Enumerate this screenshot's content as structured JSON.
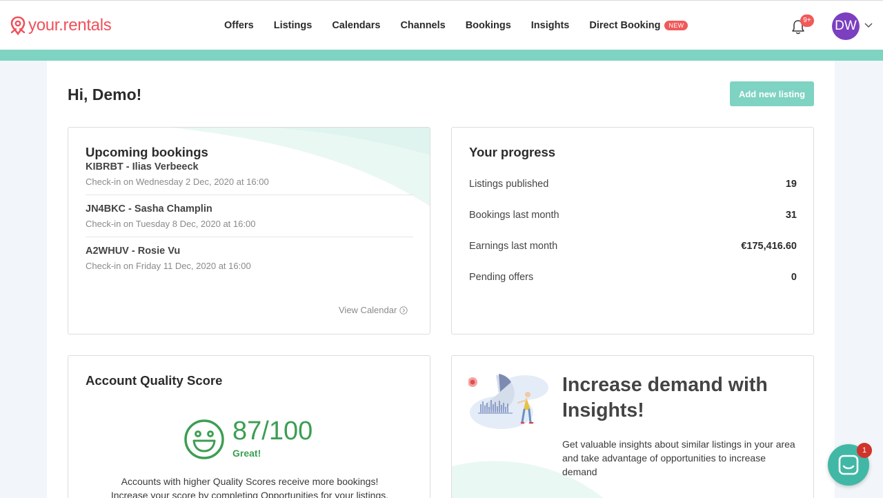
{
  "brand": {
    "name": "your.rentals",
    "color": "#f0505a"
  },
  "nav": {
    "items": [
      {
        "label": "Offers"
      },
      {
        "label": "Listings"
      },
      {
        "label": "Calendars"
      },
      {
        "label": "Channels"
      },
      {
        "label": "Bookings"
      },
      {
        "label": "Insights"
      },
      {
        "label": "Direct Booking",
        "badge": "NEW"
      }
    ]
  },
  "notifications": {
    "count": "9+",
    "icon": "bell-icon"
  },
  "user": {
    "initials": "DW",
    "avatar_color": "#7b3fbf"
  },
  "page": {
    "greeting": "Hi, Demo!",
    "add_listing_label": "Add new listing",
    "accent": "#7ed3c2"
  },
  "bookings": {
    "title": "Upcoming bookings",
    "items": [
      {
        "name": "KIBRBT - Ilias Verbeeck",
        "checkin": "Check-in on Wednesday 2 Dec, 2020 at 16:00"
      },
      {
        "name": "JN4BKC - Sasha Champlin",
        "checkin": "Check-in on Tuesday 8 Dec, 2020 at 16:00"
      },
      {
        "name": "A2WHUV - Rosie Vu",
        "checkin": "Check-in on Friday 11 Dec, 2020 at 16:00"
      }
    ],
    "view_calendar": "View Calendar"
  },
  "progress": {
    "title": "Your progress",
    "rows": [
      {
        "label": "Listings published",
        "value": "19"
      },
      {
        "label": "Bookings last month",
        "value": "31"
      },
      {
        "label": "Earnings last month",
        "value": "€175,416.60"
      },
      {
        "label": "Pending offers",
        "value": "0"
      }
    ]
  },
  "quality": {
    "title": "Account Quality Score",
    "score": "87/100",
    "rating": "Great!",
    "text_line1": "Accounts with higher Quality Scores receive more bookings!",
    "text_line2": "Increase your score by completing Opportunities for your listings.",
    "color": "#3c9e52"
  },
  "insights": {
    "title": "Increase demand with Insights!",
    "text": "Get valuable insights about similar listings in your area and take advantage of opportunities to increase demand"
  },
  "chat": {
    "badge": "1",
    "color": "#41b8a6"
  }
}
